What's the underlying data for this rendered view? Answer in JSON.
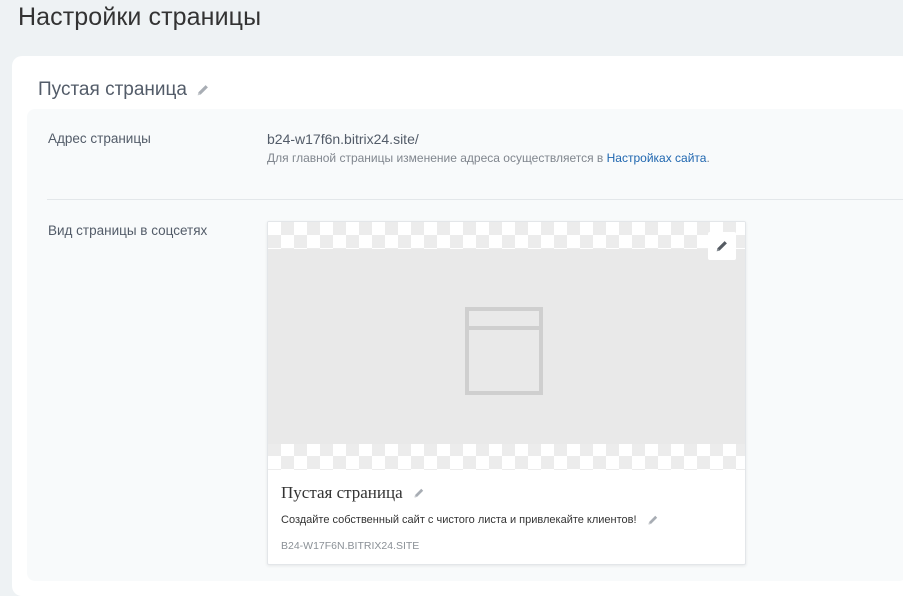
{
  "page": {
    "title": "Настройки страницы"
  },
  "block": {
    "title": "Пустая страница"
  },
  "address": {
    "label": "Адрес страницы",
    "value": "b24-w17f6n.bitrix24.site/",
    "hint_prefix": "Для главной страницы изменение адреса осуществляется в ",
    "hint_link": "Настройках сайта",
    "hint_suffix": "."
  },
  "social": {
    "label": "Вид страницы в соцсетях",
    "preview": {
      "title": "Пустая страница",
      "description": "Создайте собственный сайт с чистого листа и привлекайте клиентов!",
      "url": "B24-W17F6N.BITRIX24.SITE"
    }
  },
  "icons": {
    "title_edit": "pencil-icon",
    "image_edit": "pencil-icon",
    "placeholder": "page-layout-icon"
  },
  "colors": {
    "background": "#eef2f4",
    "link": "#2067b0",
    "muted_text": "#535c69"
  }
}
